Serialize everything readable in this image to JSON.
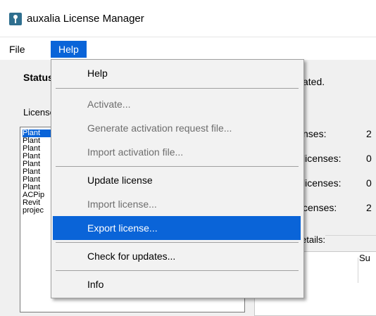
{
  "window": {
    "title": "auxalia License Manager"
  },
  "menubar": {
    "file": "File",
    "help": "Help"
  },
  "status": {
    "label": "Status",
    "tail": "ated."
  },
  "licenses": {
    "label": "Licenses",
    "items": [
      "Plant",
      "Plant",
      "Plant",
      "Plant",
      "Plant",
      "Plant",
      "Plant",
      "Plant",
      "ACPip",
      "Revit",
      "projec"
    ]
  },
  "stats": [
    {
      "label": "nses:",
      "value": "2"
    },
    {
      "label": "licenses:",
      "value": "0"
    },
    {
      "label": "licenses:",
      "value": "0"
    },
    {
      "label": "censes:",
      "value": "2"
    }
  ],
  "details": {
    "label": "etails:",
    "col_header": "Su"
  },
  "help_menu": {
    "items": [
      {
        "label": "Help",
        "enabled": true
      },
      {
        "label": "Activate...",
        "enabled": false
      },
      {
        "label": "Generate activation request file...",
        "enabled": false
      },
      {
        "label": "Import activation file...",
        "enabled": false
      },
      {
        "label": "Update license",
        "enabled": true
      },
      {
        "label": "Import license...",
        "enabled": false
      },
      {
        "label": "Export license...",
        "enabled": true,
        "highlighted": true
      },
      {
        "label": "Check for updates...",
        "enabled": true
      },
      {
        "label": "Info",
        "enabled": true
      }
    ]
  },
  "colors": {
    "accent": "#0a64d8",
    "disabled_text": "#6d6d6d",
    "menu_bg": "#f2f2f2"
  },
  "icons": {
    "app": "key-license-icon"
  }
}
